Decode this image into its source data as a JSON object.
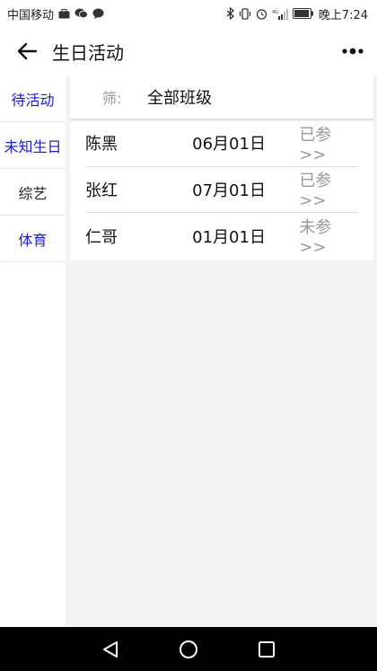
{
  "status_bar": {
    "carrier": "中国移动",
    "time": "晚上7:24"
  },
  "header": {
    "title": "生日活动"
  },
  "sidebar": {
    "items": [
      {
        "label": "待活动",
        "color": "#1a1adc"
      },
      {
        "label": "未知生日",
        "color": "#1a1adc"
      },
      {
        "label": "综艺",
        "color": "#222222"
      },
      {
        "label": "体育",
        "color": "#1a1adc"
      }
    ]
  },
  "filter": {
    "label": "筛:",
    "value": "全部班级"
  },
  "list": {
    "rows": [
      {
        "name": "陈黑",
        "date": "06月01日",
        "status": "已参>>"
      },
      {
        "name": "张红",
        "date": "07月01日",
        "status": "已参>>"
      },
      {
        "name": "仁哥",
        "date": "01月01日",
        "status": "未参>>"
      }
    ]
  },
  "colors": {
    "accent_blue": "#1a1adc",
    "muted_text": "#999999",
    "background": "#f2f3f5"
  }
}
